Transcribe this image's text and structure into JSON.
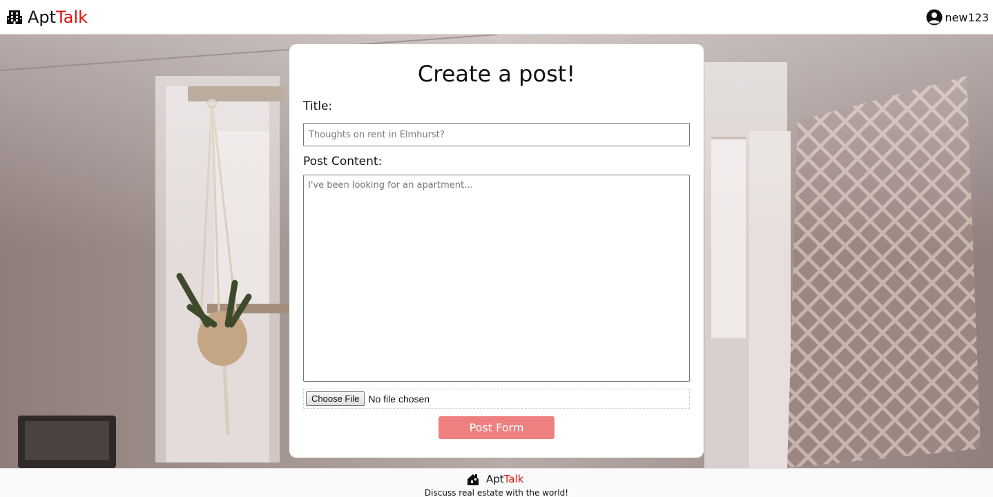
{
  "app": {
    "brand_main": "Apt",
    "brand_accent": "Talk",
    "accent_color": "#e01313",
    "logo_icon": "building-icon"
  },
  "user": {
    "username": "new123",
    "icon": "user-circle-icon"
  },
  "form": {
    "heading": "Create a post!",
    "title_label": "Title:",
    "title_placeholder": "Thoughts on rent in Elmhurst?",
    "title_value": "",
    "content_label": "Post Content:",
    "content_placeholder": "I've been looking for an apartment...",
    "content_value": "",
    "file_button_label": "Choose File",
    "file_status": "No file chosen",
    "submit_label": "Post Form",
    "submit_color": "#ef8080"
  },
  "footer": {
    "brand_main": "Apt",
    "brand_accent": "Talk",
    "icon": "house-icon",
    "tagline": "Discuss real estate with the world!"
  }
}
